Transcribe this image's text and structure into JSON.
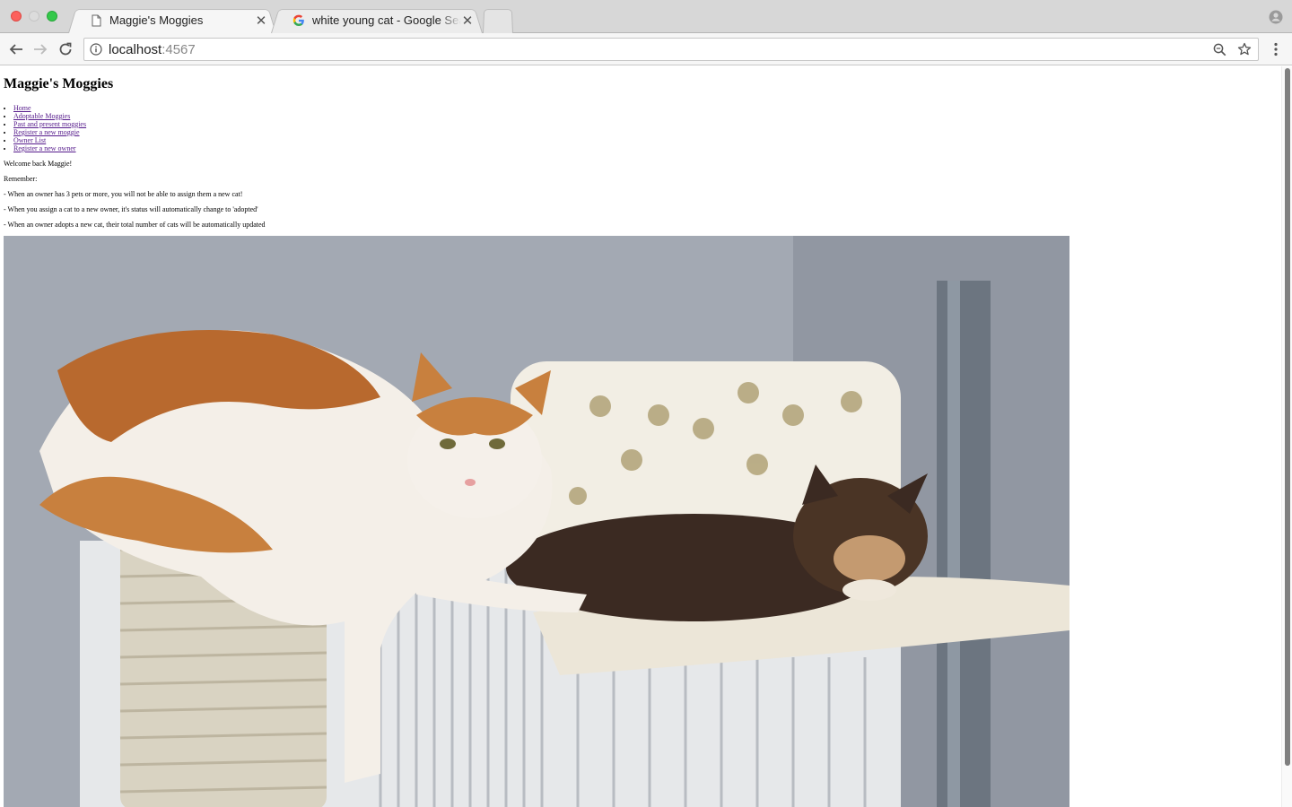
{
  "browser": {
    "tabs": [
      {
        "title": "Maggie's Moggies",
        "active": true,
        "icon": "page-icon"
      },
      {
        "title": "white young cat - Google Search",
        "active": false,
        "icon": "google-g-icon"
      }
    ],
    "url": {
      "host": "localhost",
      "port": ":4567"
    }
  },
  "page": {
    "title": "Maggie's Moggies",
    "nav": [
      "Home",
      "Adoptable Moggies",
      "Past and present moggies",
      "Register a new moggie",
      "Owner List",
      "Register a new owner"
    ],
    "welcome": "Welcome back Maggie!",
    "remember": "Remember:",
    "notes": [
      "- When an owner has 3 pets or more, you will not be able to assign them a new cat!",
      "- When you assign a cat to a new owner, it's status will automatically change to 'adopted'",
      "- When an owner adopts a new cat, their total number of cats will be automatically updated"
    ]
  },
  "colors": {
    "link_visited": "#551a8b",
    "traffic_close": "#fc605c",
    "traffic_max": "#34c84a"
  }
}
